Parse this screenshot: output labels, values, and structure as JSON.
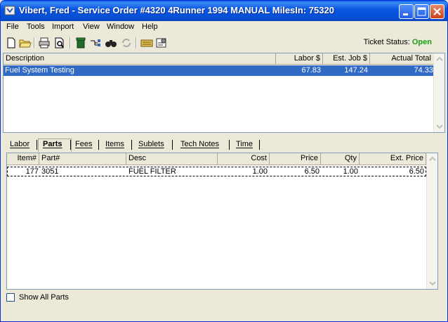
{
  "window": {
    "title": "Vibert, Fred - Service Order #4320  4Runner 1994 MANUAL  MilesIn: 75320"
  },
  "menu": [
    "File",
    "Tools",
    "Import",
    "View",
    "Window",
    "Help"
  ],
  "toolbar": {
    "icons": [
      "new-document-icon",
      "open-folder-icon",
      "print-icon",
      "print-preview-icon",
      "trash-icon",
      "tree-icon",
      "binoculars-icon",
      "refresh-icon",
      "keyboard-icon",
      "settings-icon"
    ]
  },
  "ticket_status": {
    "label": "Ticket Status:",
    "value": "Open",
    "color": "#16a016"
  },
  "jobs": {
    "columns": [
      "Description",
      "Labor $",
      "Est. Job $",
      "Actual Total"
    ],
    "rows": [
      {
        "description": "Fuel System Testing",
        "labor": "67.83",
        "est_job": "147.24",
        "actual_total": "74.33"
      }
    ]
  },
  "tabs": [
    "Labor",
    "Parts",
    "Fees",
    "Items",
    "Sublets",
    "Tech Notes",
    "Time"
  ],
  "active_tab": "Parts",
  "parts": {
    "columns": [
      "Item#",
      "Part#",
      "Desc",
      "Cost",
      "Price",
      "Qty",
      "Ext. Price"
    ],
    "rows": [
      {
        "item": "177",
        "part": "3051",
        "desc": "FUEL FILTER",
        "cost": "1.00",
        "price": "6.50",
        "qty": "1.00",
        "ext_price": "6.50"
      }
    ]
  },
  "show_all_parts": {
    "label": "Show All Parts",
    "checked": false
  },
  "colors": {
    "selection": "#316ac5",
    "titlebar": "#0650d8"
  }
}
